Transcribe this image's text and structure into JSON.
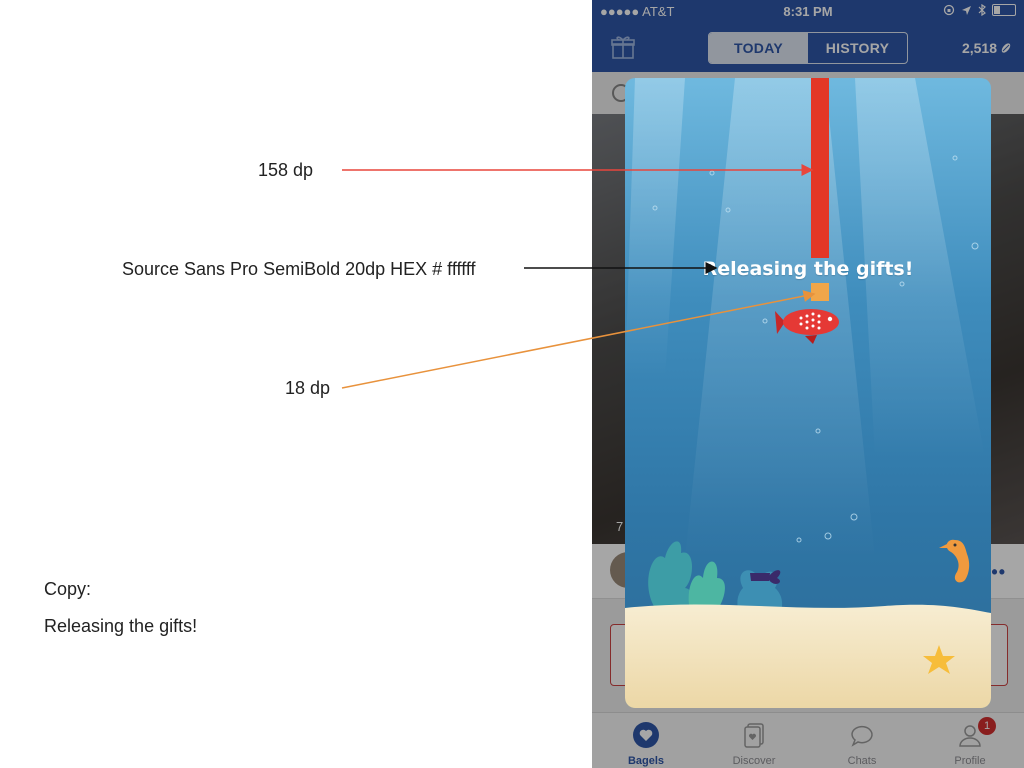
{
  "annotations": {
    "height_label": "158 dp",
    "font_label": "Source Sans Pro SemiBold 20dp HEX # ffffff",
    "box_label": "18 dp",
    "copy_heading": "Copy:",
    "copy_text": "Releasing the gifts!",
    "colors": {
      "height_arrow": "#e8463c",
      "font_arrow": "#111111",
      "box_arrow": "#e8923c"
    }
  },
  "status_bar": {
    "carrier": "●●●●● AT&T",
    "time": "8:31 PM"
  },
  "nav": {
    "tabs": [
      {
        "label": "TODAY",
        "active": true
      },
      {
        "label": "HISTORY",
        "active": false
      }
    ],
    "bean_count": "2,518"
  },
  "modal": {
    "message": "Releasing the gifts!",
    "colors": {
      "line": "#e33726",
      "gift_box": "#f0a64a",
      "text": "#ffffff",
      "water_top": "#6fb9df",
      "water_bottom": "#2c6b97",
      "sand": "#f3e4bd"
    }
  },
  "background": {
    "photo_corner_text": "7"
  },
  "tab_bar": {
    "tabs": [
      {
        "label": "Bagels",
        "icon": "heart-icon",
        "active": true
      },
      {
        "label": "Discover",
        "icon": "cards-icon",
        "active": false
      },
      {
        "label": "Chats",
        "icon": "chat-bubble-icon",
        "active": false
      },
      {
        "label": "Profile",
        "icon": "person-icon",
        "active": false,
        "badge": "1"
      }
    ]
  }
}
